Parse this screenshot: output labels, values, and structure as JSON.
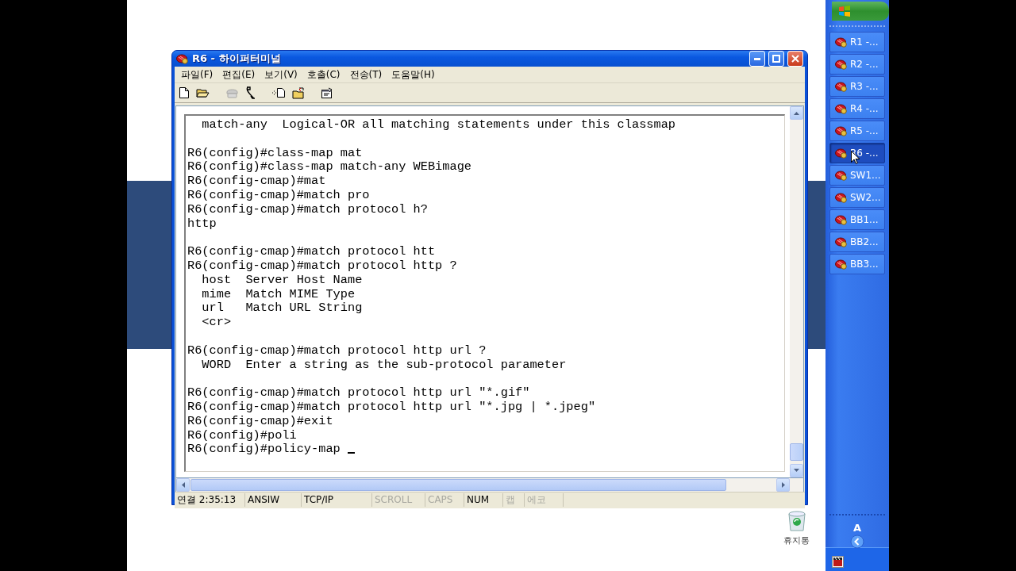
{
  "window": {
    "title": "R6 - 하이퍼터미널",
    "menu": [
      "파일(F)",
      "편집(E)",
      "보기(V)",
      "호출(C)",
      "전송(T)",
      "도움말(H)"
    ],
    "toolbar": [
      {
        "kind": "document",
        "disabled": false
      },
      {
        "kind": "folder",
        "disabled": false
      },
      {
        "kind": "phone",
        "disabled": true
      },
      {
        "kind": "handset",
        "disabled": false
      },
      {
        "kind": "send",
        "disabled": false
      },
      {
        "kind": "receive",
        "disabled": false
      },
      {
        "kind": "properties",
        "disabled": false
      }
    ],
    "terminal": {
      "blocks": [
        [
          "  match-any  Logical-OR all matching statements under this classmap"
        ],
        [
          "R6(config)#class-map mat",
          "R6(config)#class-map match-any WEBimage",
          "R6(config-cmap)#mat",
          "R6(config-cmap)#match pro",
          "R6(config-cmap)#match protocol h?",
          "http"
        ],
        [
          "R6(config-cmap)#match protocol htt",
          "R6(config-cmap)#match protocol http ?",
          "  host  Server Host Name",
          "  mime  Match MIME Type",
          "  url   Match URL String",
          "  <cr>"
        ],
        [
          "R6(config-cmap)#match protocol http url ?",
          "  WORD  Enter a string as the sub-protocol parameter"
        ],
        [
          "R6(config-cmap)#match protocol http url \"*.gif\"",
          "R6(config-cmap)#match protocol http url \"*.jpg | *.jpeg\"",
          "R6(config-cmap)#exit",
          "R6(config)#poli",
          "R6(config)#policy-map "
        ]
      ],
      "cursor": true
    },
    "status_bar": [
      {
        "text": "연결 2:35:13",
        "disabled": false
      },
      {
        "text": "ANSIW",
        "disabled": false
      },
      {
        "text": "TCP/IP",
        "disabled": false
      },
      {
        "text": "SCROLL",
        "disabled": true
      },
      {
        "text": "CAPS",
        "disabled": true
      },
      {
        "text": "NUM",
        "disabled": false
      },
      {
        "text": "캡",
        "disabled": true
      },
      {
        "text": "에코",
        "disabled": true
      }
    ]
  },
  "desktop_icons": [
    {
      "label": "휴지통"
    }
  ],
  "taskbar": {
    "items": [
      {
        "label": "R1 -...",
        "selected": false
      },
      {
        "label": "R2 -...",
        "selected": false
      },
      {
        "label": "R3 -...",
        "selected": false
      },
      {
        "label": "R4 -...",
        "selected": false
      },
      {
        "label": "R5 -...",
        "selected": false
      },
      {
        "label": "R6 -...",
        "selected": true
      },
      {
        "label": "SW1...",
        "selected": false
      },
      {
        "label": "SW2...",
        "selected": false
      },
      {
        "label": "BB1...",
        "selected": false
      },
      {
        "label": "BB2...",
        "selected": false
      },
      {
        "label": "BB3...",
        "selected": false
      }
    ],
    "tray_label": "A"
  }
}
